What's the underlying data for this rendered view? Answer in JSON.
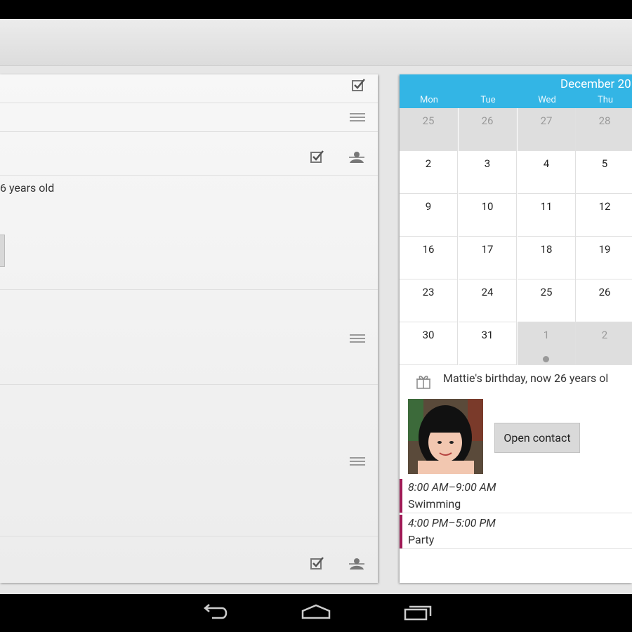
{
  "calendar": {
    "month_title": "December 20",
    "weekdays": [
      "Mon",
      "Tue",
      "Wed",
      "Thu"
    ],
    "weeks": [
      [
        {
          "d": "25",
          "other": true
        },
        {
          "d": "26",
          "other": true
        },
        {
          "d": "27",
          "other": true
        },
        {
          "d": "28",
          "other": true
        }
      ],
      [
        {
          "d": "2"
        },
        {
          "d": "3"
        },
        {
          "d": "4"
        },
        {
          "d": "5"
        }
      ],
      [
        {
          "d": "9"
        },
        {
          "d": "10"
        },
        {
          "d": "11"
        },
        {
          "d": "12"
        }
      ],
      [
        {
          "d": "16"
        },
        {
          "d": "17"
        },
        {
          "d": "18"
        },
        {
          "d": "19"
        }
      ],
      [
        {
          "d": "23"
        },
        {
          "d": "24"
        },
        {
          "d": "25"
        },
        {
          "d": "26"
        }
      ],
      [
        {
          "d": "30"
        },
        {
          "d": "31"
        },
        {
          "d": "1",
          "other": true,
          "dot": true
        },
        {
          "d": "2",
          "other": true
        }
      ]
    ],
    "colors": {
      "header": "#33b5e5",
      "event_bar": "#a01a56"
    }
  },
  "birthday": {
    "text": "Mattie's birthday, now 26 years ol",
    "open_contact_label": "Open contact"
  },
  "events": [
    {
      "time": "8:00 AM–9:00 AM",
      "title": "Swimming"
    },
    {
      "time": "4:00 PM–5:00 PM",
      "title": "Party"
    }
  ],
  "left_panel": {
    "partial_text": "6 years old"
  }
}
